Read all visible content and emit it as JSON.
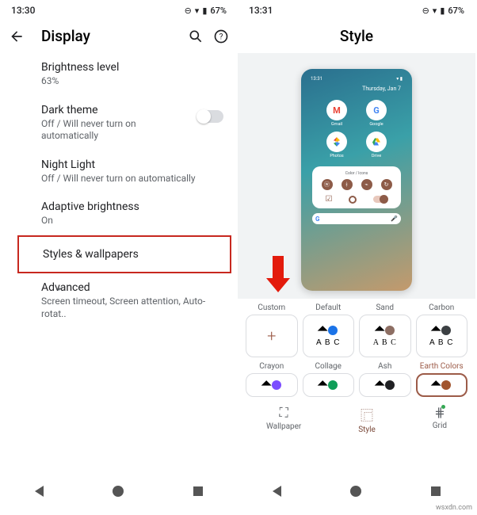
{
  "left": {
    "status": {
      "time": "13:30",
      "battery": "67%"
    },
    "title": "Display",
    "items": {
      "brightness": {
        "primary": "Brightness level",
        "secondary": "63%"
      },
      "dark": {
        "primary": "Dark theme",
        "secondary": "Off / Will never turn on automatically"
      },
      "night": {
        "primary": "Night Light",
        "secondary": "Off / Will never turn on automatically"
      },
      "adaptive": {
        "primary": "Adaptive brightness",
        "secondary": "On"
      },
      "styles": {
        "primary": "Styles & wallpapers"
      },
      "advanced": {
        "primary": "Advanced",
        "secondary": "Screen timeout, Screen attention, Auto-rotat.."
      }
    }
  },
  "right": {
    "status": {
      "time": "13:31",
      "battery": "67%"
    },
    "title": "Style",
    "preview": {
      "time": "13:31",
      "date": "Thursday, Jan 7",
      "apps": {
        "gmail": "Gmail",
        "google": "Google",
        "photos": "Photos",
        "drive": "Drive"
      },
      "card_header": "Color / Icons"
    },
    "styles": [
      {
        "label": "Custom",
        "plus": true
      },
      {
        "label": "Default",
        "dot": "#1a73e8",
        "abc": "A B C",
        "abc_font": "sans-serif"
      },
      {
        "label": "Sand",
        "dot": "#8d6e63",
        "abc": "A B C",
        "abc_font": "serif"
      },
      {
        "label": "Carbon",
        "dot": "#3c4043",
        "abc": "A B C",
        "abc_font": "sans-serif"
      },
      {
        "label": "Crayon",
        "dot": "#7c4dff",
        "short": true
      },
      {
        "label": "Collage",
        "dot": "#0f9d58",
        "short": true
      },
      {
        "label": "Ash",
        "dot": "#202124",
        "short": true
      },
      {
        "label": "Earth Colors",
        "dot": "#a1552e",
        "short": true,
        "selected": true
      }
    ],
    "tabs": {
      "wallpaper": "Wallpaper",
      "style": "Style",
      "grid": "Grid"
    }
  },
  "watermark": "wsxdn.com"
}
